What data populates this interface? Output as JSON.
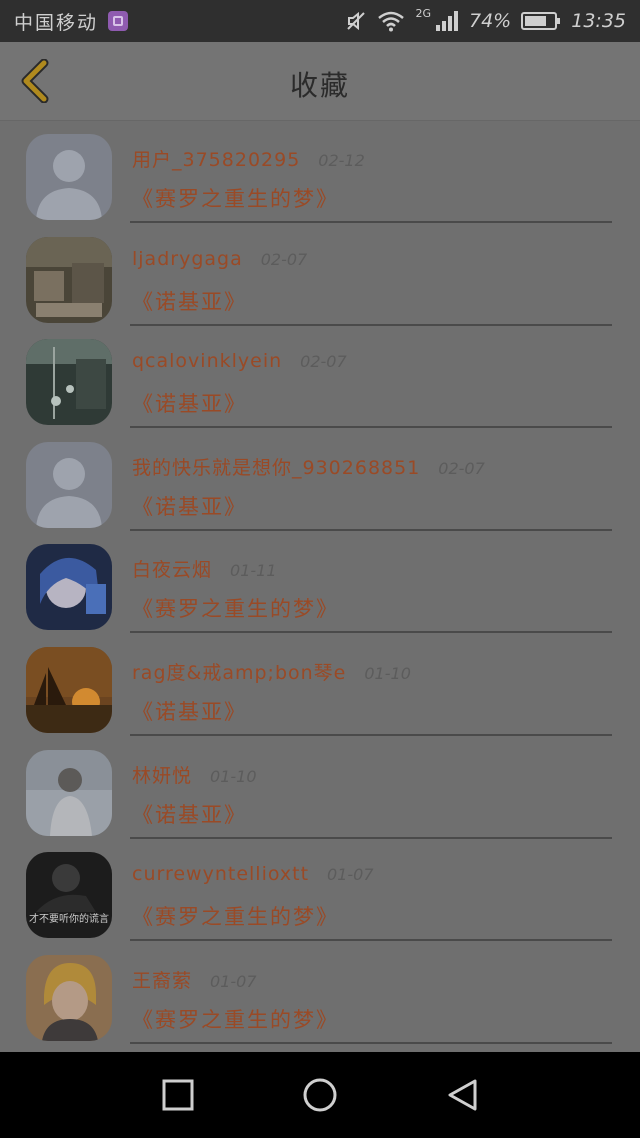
{
  "status_bar": {
    "carrier": "中国移动",
    "network_type": "2G",
    "battery_percent": "74%",
    "time": "13:35",
    "battery_level": 0.74
  },
  "header": {
    "title": "收藏"
  },
  "items": [
    {
      "username": "用户_375820295",
      "date": "02-12",
      "book": "《赛罗之重生的梦》",
      "avatar": "default-avatar"
    },
    {
      "username": "ljadrygaga",
      "date": "02-07",
      "book": "《诺基亚》",
      "avatar": "room-photo-avatar"
    },
    {
      "username": "qcalovinklyein",
      "date": "02-07",
      "book": "《诺基亚》",
      "avatar": "city-photo-avatar"
    },
    {
      "username": "我的快乐就是想你_930268851",
      "date": "02-07",
      "book": "《诺基亚》",
      "avatar": "default-avatar"
    },
    {
      "username": "白夜云烟",
      "date": "01-11",
      "book": "《赛罗之重生的梦》",
      "avatar": "anime-girl-avatar"
    },
    {
      "username": "rag度&戒amp;bon琴e",
      "date": "01-10",
      "book": "《诺基亚》",
      "avatar": "sunset-boat-avatar"
    },
    {
      "username": "林妍悦",
      "date": "01-10",
      "book": "《诺基亚》",
      "avatar": "girl-photo-avatar"
    },
    {
      "username": "currewyntellioxtt",
      "date": "01-07",
      "book": "《赛罗之重生的梦》",
      "avatar": "dark-photo-avatar",
      "avatar_caption": "才不要听你的谎言"
    },
    {
      "username": "王裔萦",
      "date": "01-07",
      "book": "《赛罗之重生的梦》",
      "avatar": "anime-boy-avatar"
    }
  ],
  "colors": {
    "username": "#9a4a26",
    "book_title": "#9a4a26",
    "back_arrow": "#b08a1e"
  }
}
